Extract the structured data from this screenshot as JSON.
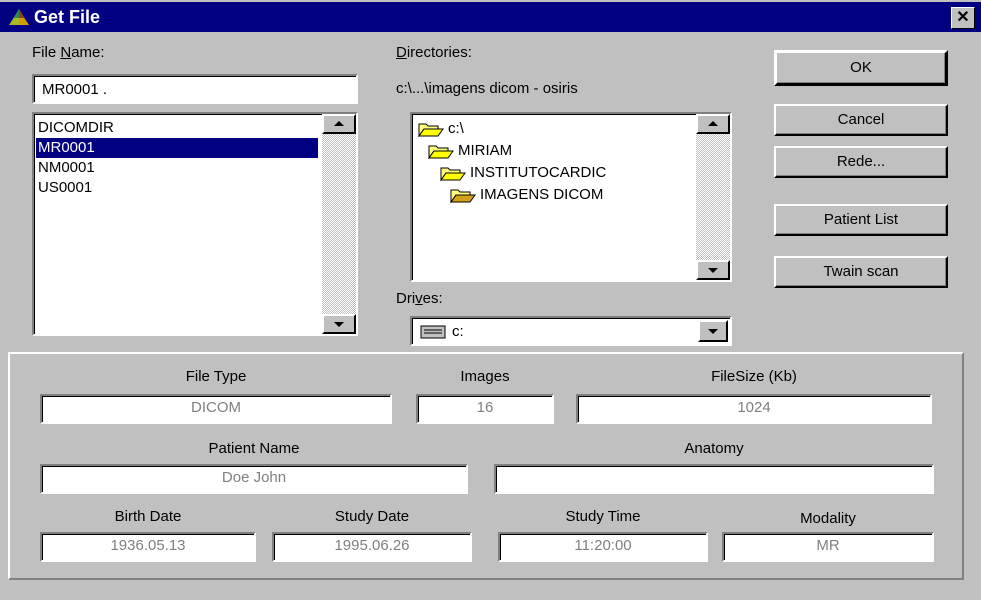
{
  "window": {
    "title": "Get File"
  },
  "file_name": {
    "label_pre": "File ",
    "label_u": "N",
    "label_post": "ame:",
    "value": "MR0001 ."
  },
  "file_list": {
    "items": [
      "DICOMDIR",
      "MR0001",
      "NM0001",
      "US0001"
    ],
    "selected_index": 1
  },
  "directories": {
    "label_u": "D",
    "label_post": "irectories:",
    "current_path": "c:\\...\\imagens dicom - osiris",
    "tree": [
      "c:\\",
      "MIRIAM",
      "INSTITUTOCARDIC",
      "IMAGENS DICOM"
    ]
  },
  "drives": {
    "label_pre": "Dri",
    "label_u": "v",
    "label_post": "es:",
    "selected": "c:"
  },
  "buttons": {
    "ok": "OK",
    "cancel": "Cancel",
    "rede": "Rede...",
    "patient_list": "Patient List",
    "twain_scan": "Twain scan"
  },
  "info": {
    "file_type_label": "File Type",
    "file_type": "DICOM",
    "images_label": "Images",
    "images": "16",
    "filesize_label": "FileSize (Kb)",
    "filesize": "1024",
    "patient_name_label": "Patient Name",
    "patient_name": "Doe John",
    "anatomy_label": "Anatomy",
    "anatomy": "",
    "birth_date_label": "Birth Date",
    "birth_date": "1936.05.13",
    "study_date_label": "Study Date",
    "study_date": "1995.06.26",
    "study_time_label": "Study Time",
    "study_time": "11:20:00",
    "modality_label": "Modality",
    "modality": "MR"
  },
  "colors": {
    "titlebar": "#000080",
    "face": "#c0c0c0",
    "selection": "#000080"
  },
  "icons": [
    "app-pyramid-icon",
    "close-icon",
    "folder-open-icon",
    "drive-icon",
    "scroll-up-icon",
    "scroll-down-icon",
    "dropdown-arrow-icon"
  ]
}
